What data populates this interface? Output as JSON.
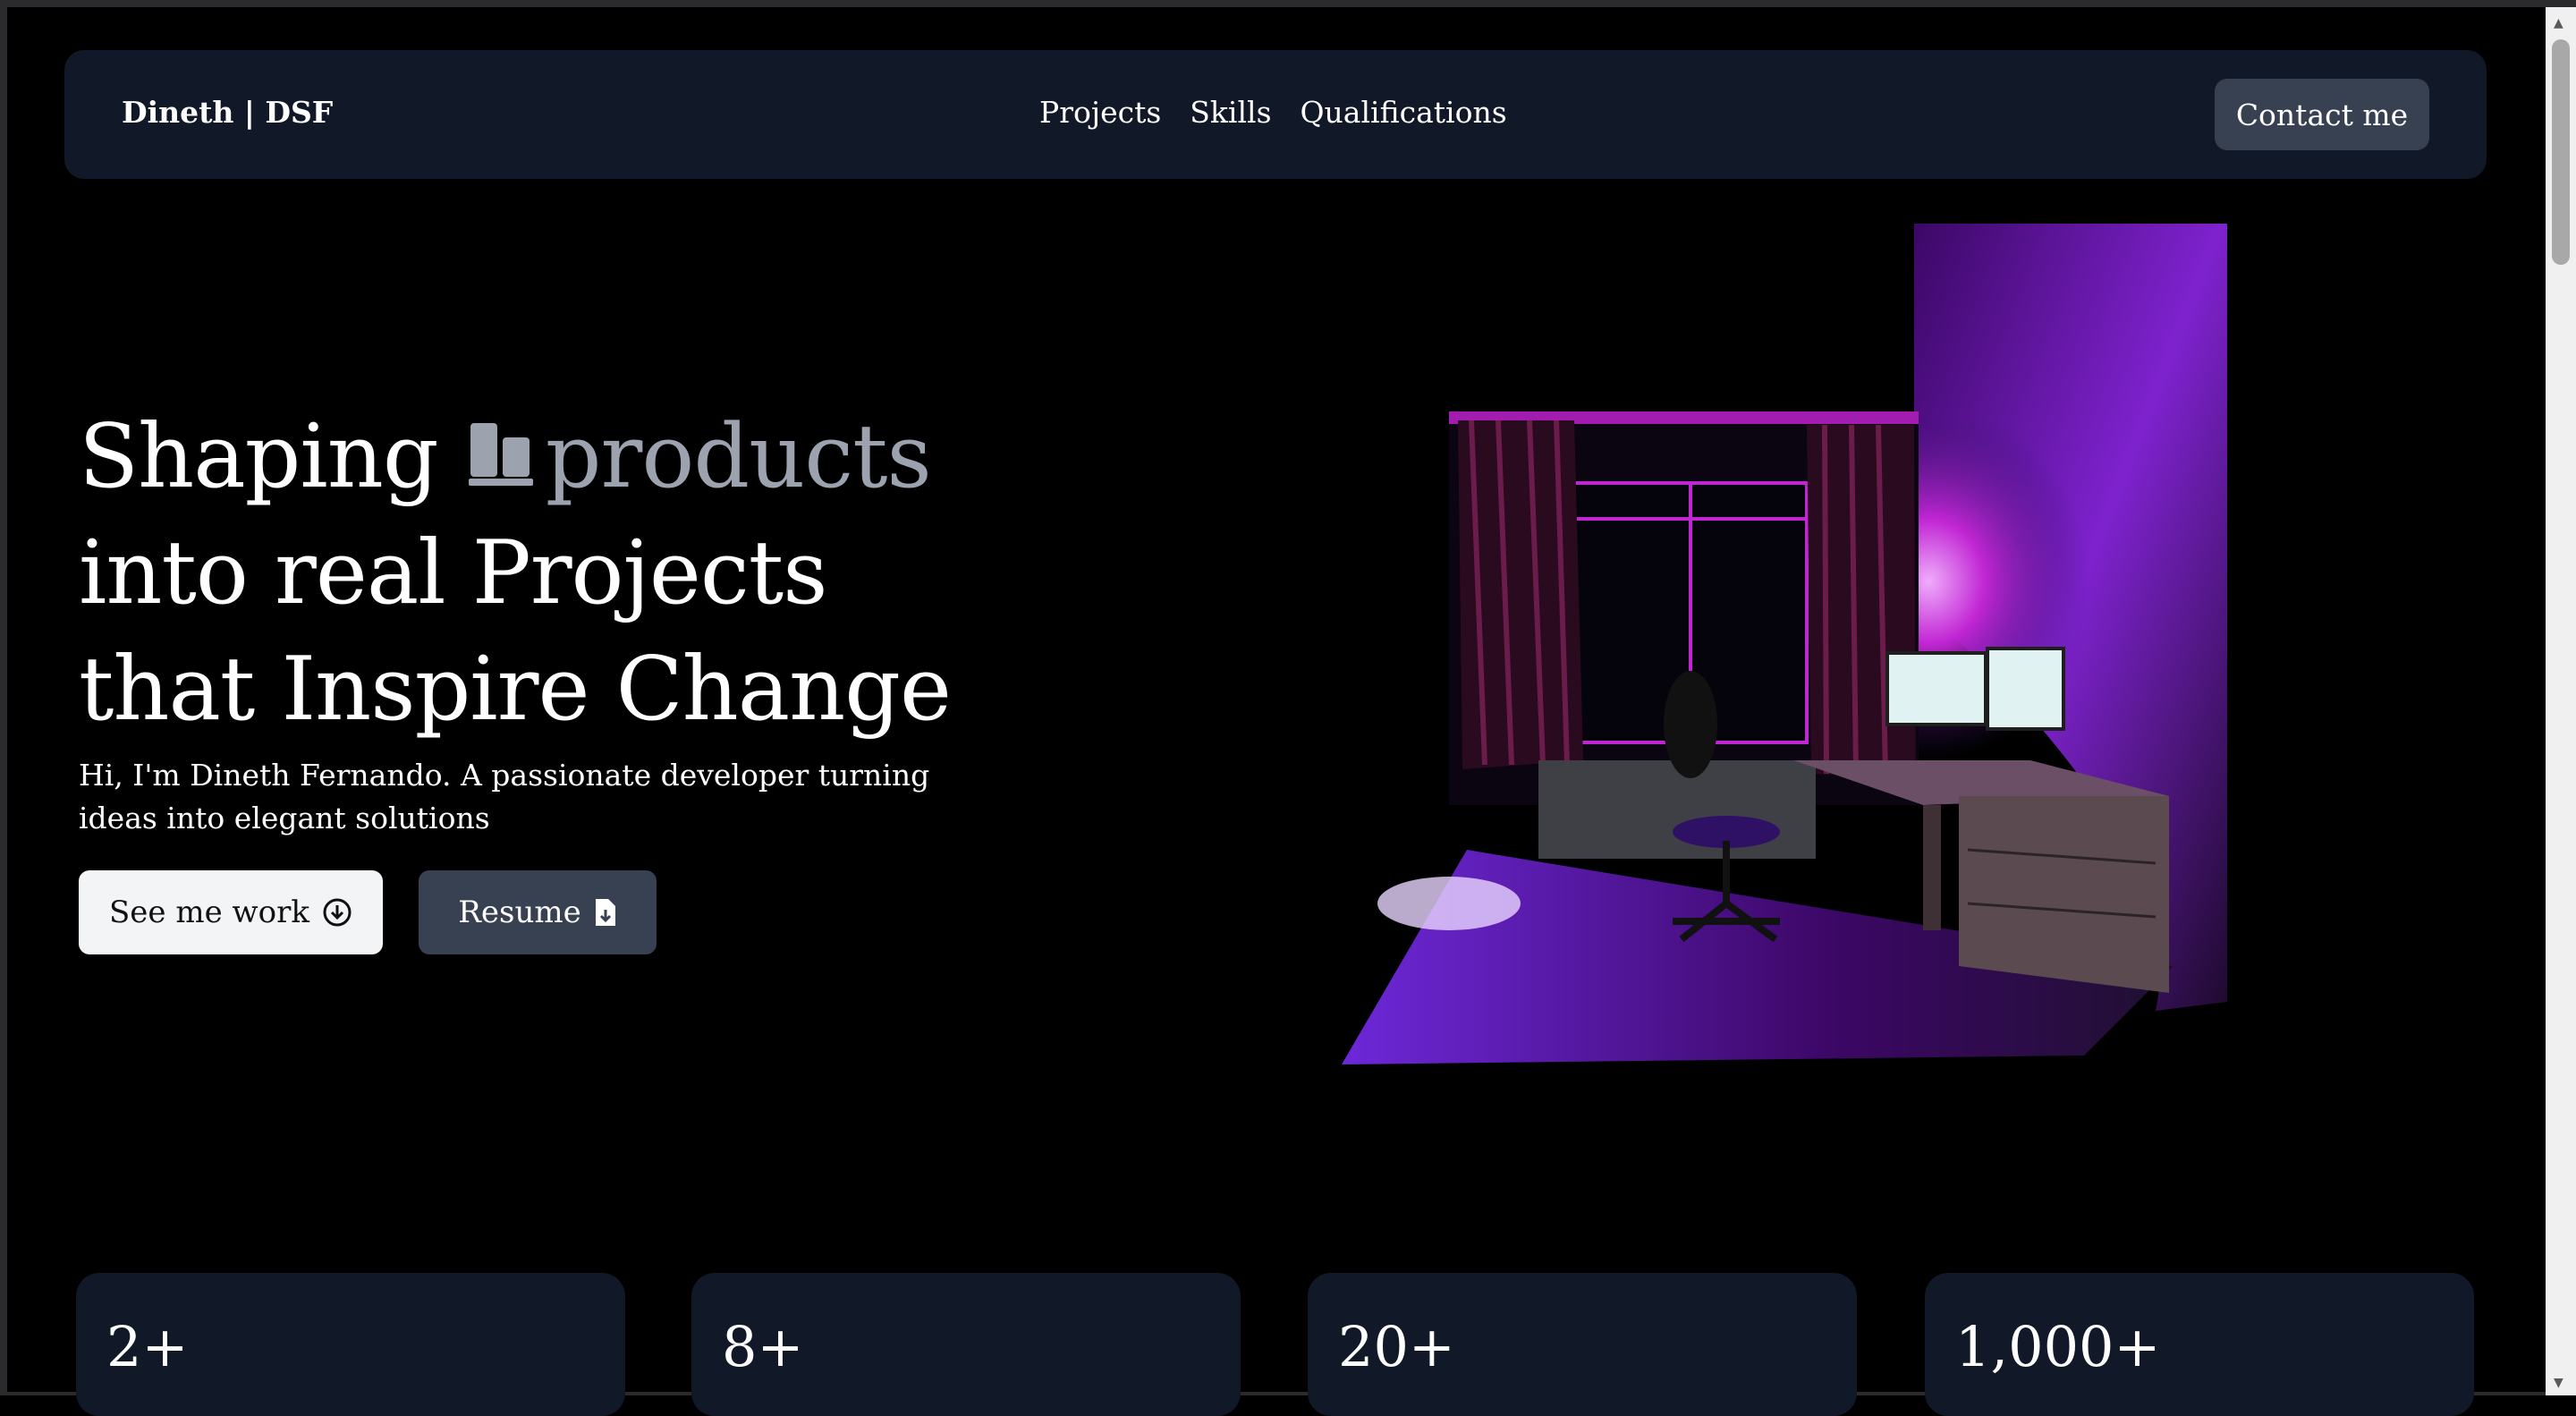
{
  "nav": {
    "brand": "Dineth | DSF",
    "links": [
      "Projects",
      "Skills",
      "Qualifications"
    ],
    "contact_label": "Contact me"
  },
  "hero": {
    "line1_a": "Shaping",
    "line1_b": "products",
    "line2": "into real Projects",
    "line3": "that Inspire Change",
    "subtitle": "Hi, I'm Dineth Fernando. A passionate developer turning ideas into elegant solutions",
    "primary_button": "See me work",
    "secondary_button": "Resume"
  },
  "stats": [
    {
      "value": "2+"
    },
    {
      "value": "8+"
    },
    {
      "value": "20+"
    },
    {
      "value": "1,000+"
    }
  ],
  "colors": {
    "background": "#000000",
    "card": "#111827",
    "button_dark": "#374151",
    "muted_text": "#9ca3af",
    "accent_purple": "#a21caf"
  },
  "icons": {
    "product_icon": "product-blocks-icon",
    "primary_button_icon": "arrow-down-circle-icon",
    "secondary_button_icon": "file-download-icon"
  }
}
